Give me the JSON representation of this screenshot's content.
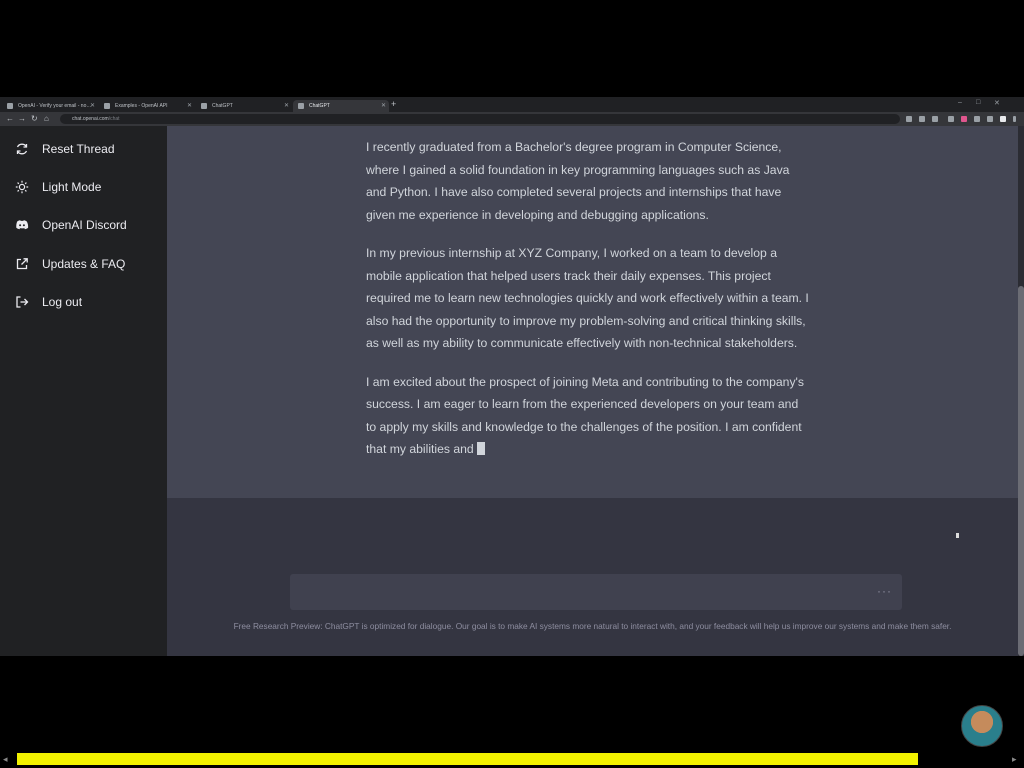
{
  "browser": {
    "tabs": [
      {
        "label": "OpenAI - Verify your email - no…",
        "active": false
      },
      {
        "label": "Examples - OpenAI API",
        "active": false
      },
      {
        "label": "ChatGPT",
        "active": false
      },
      {
        "label": "ChatGPT",
        "active": true
      }
    ],
    "new_tab": "+",
    "window_controls": {
      "minimize": "–",
      "maximize": "□",
      "close": "✕"
    },
    "url_host": "chat.openai.com",
    "url_path": "/chat"
  },
  "sidebar": {
    "items": [
      {
        "label": "Reset Thread",
        "icon": "refresh-icon"
      },
      {
        "label": "Light Mode",
        "icon": "sun-icon"
      },
      {
        "label": "OpenAI Discord",
        "icon": "discord-icon"
      },
      {
        "label": "Updates & FAQ",
        "icon": "external-link-icon"
      },
      {
        "label": "Log out",
        "icon": "logout-icon"
      }
    ]
  },
  "conversation": {
    "paragraphs": [
      "I recently graduated from a Bachelor's degree program in Computer Science, where I gained a solid foundation in key programming languages such as Java and Python. I have also completed several projects and internships that have given me experience in developing and debugging applications.",
      "In my previous internship at XYZ Company, I worked on a team to develop a mobile application that helped users track their daily expenses. This project required me to learn new technologies quickly and work effectively within a team. I also had the opportunity to improve my problem-solving and critical thinking skills, as well as my ability to communicate effectively with non-technical stakeholders.",
      "I am excited about the prospect of joining Meta and contributing to the company's success. I am eager to learn from the experienced developers on your team and to apply my skills and knowledge to the challenges of the position. I am confident that my abilities and"
    ]
  },
  "composer": {
    "status": "···"
  },
  "footer": {
    "text": "Free Research Preview: ChatGPT is optimized for dialogue. Our goal is to make AI systems more natural to interact with, and your feedback will help us improve our systems and make them safer."
  },
  "video": {
    "progress": 0.91,
    "accent": "#f2f200"
  }
}
